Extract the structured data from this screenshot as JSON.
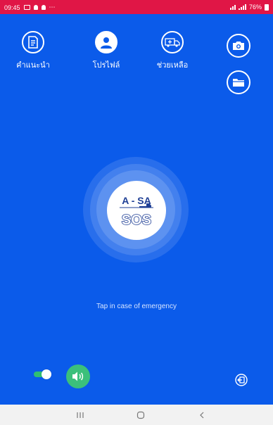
{
  "status_bar": {
    "time": "09:45",
    "battery": "76%"
  },
  "menu": {
    "guide": {
      "label": "คำแนะนำ",
      "icon": "document-icon"
    },
    "profile": {
      "label": "โปรไฟล์",
      "icon": "user-icon"
    },
    "help": {
      "label": "ช่วยเหลือ",
      "icon": "ambulance-icon"
    }
  },
  "actions": {
    "camera_icon": "camera-icon",
    "folder_icon": "folder-icon"
  },
  "sos": {
    "brand_top": "A - SA",
    "brand_bottom": "SOS"
  },
  "hint_text": "Tap in case of emergency",
  "controls": {
    "toggle_on": true,
    "sound_icon": "speaker-icon",
    "logout_icon": "logout-icon"
  },
  "colors": {
    "background": "#0b5bea",
    "status_bar": "#e01646",
    "accent_green": "#3bc07b",
    "logo_blue": "#1f5fc9"
  }
}
